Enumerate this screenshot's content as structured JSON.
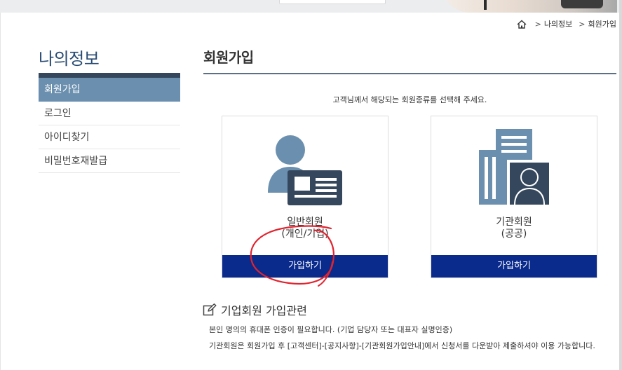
{
  "breadcrumb": {
    "home_icon": "home-icon",
    "items": [
      "나의정보",
      "회원가입"
    ],
    "separator": ">"
  },
  "sidebar": {
    "title": "나의정보",
    "items": [
      {
        "label": "회원가입",
        "active": true
      },
      {
        "label": "로그인",
        "active": false
      },
      {
        "label": "아이디찾기",
        "active": false
      },
      {
        "label": "비밀번호재발급",
        "active": false
      }
    ]
  },
  "main": {
    "title": "회원가입",
    "guide": "고객님께서 해당되는 회원종류를 선택해 주세요.",
    "cards": [
      {
        "name_line1": "일반회원",
        "name_line2": "(개인/기업)",
        "button_label": "가입하기",
        "icon": "person-id-card-icon"
      },
      {
        "name_line1": "기관회원",
        "name_line2": "(공공)",
        "button_label": "가입하기",
        "icon": "institution-building-icon"
      }
    ],
    "notice": {
      "icon": "edit-icon",
      "title": "기업회원 가입관련",
      "lines": [
        "본인 명의의 휴대폰 인증이 필요합니다. (기업 담당자 또는 대표자 실명인증)",
        "기관회원은 회원가입 후 [고객센터]-[공지사항]-[기관회원가입안내]에서 신청서를 다운받아 제출하셔야 이용 가능합니다."
      ]
    }
  },
  "colors": {
    "accent_button": "#0a2a8c",
    "sidebar_active": "#6b8fae",
    "title_text": "#274a73",
    "illustration_light": "#6b8fae",
    "illustration_dark": "#35475c",
    "annotation_red": "#e0242f"
  }
}
